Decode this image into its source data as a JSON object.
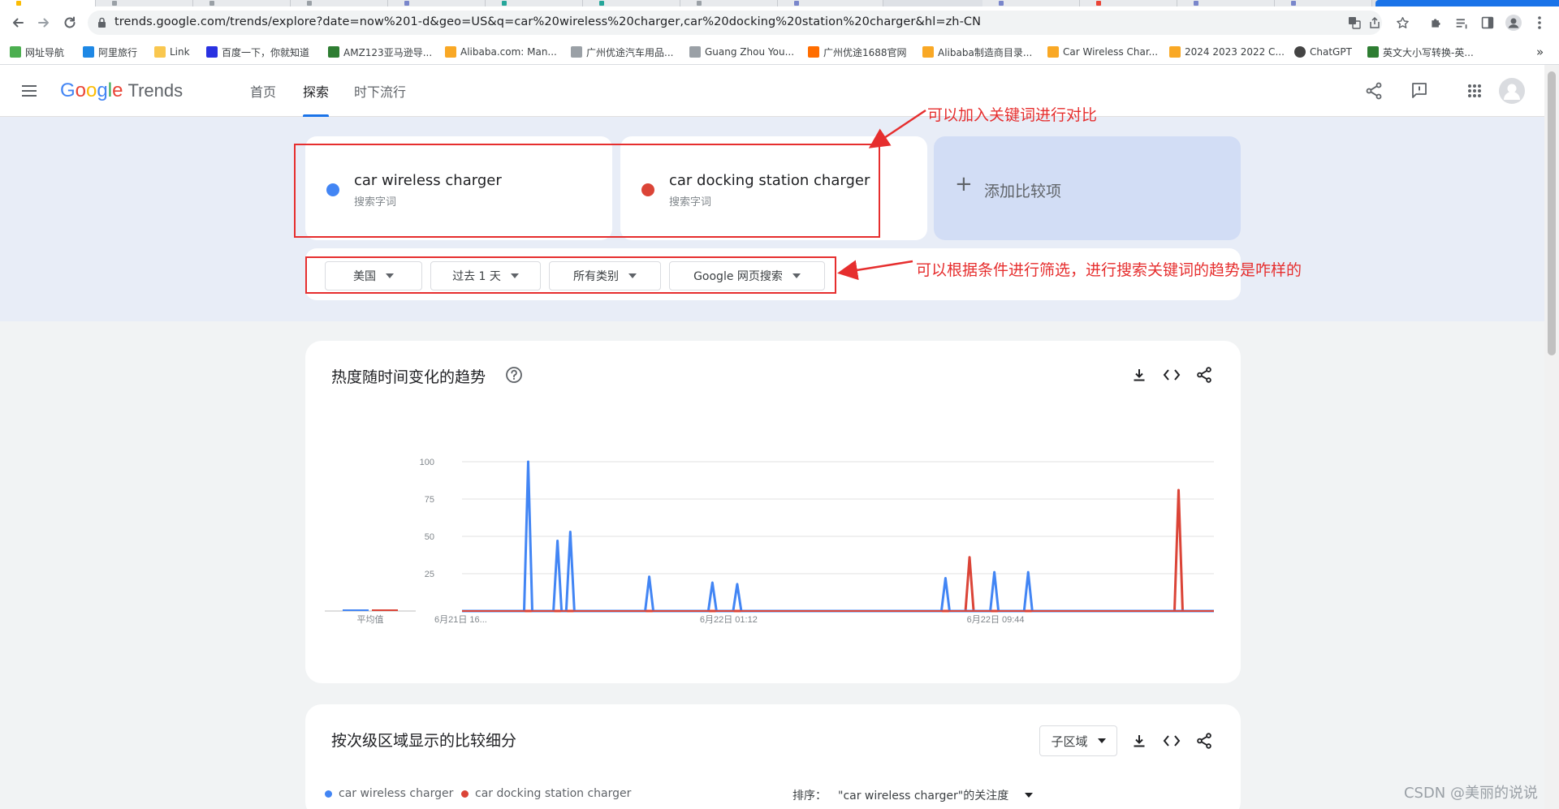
{
  "browser": {
    "url": "trends.google.com/trends/explore?date=now%201-d&geo=US&q=car%20wireless%20charger,car%20docking%20station%20charger&hl=zh-CN",
    "bookmarks": [
      {
        "label": "网址导航",
        "color": "#4caf50"
      },
      {
        "label": "阿里旅行",
        "color": "#1e88e5"
      },
      {
        "label": "Link",
        "color": "#f9c74f"
      },
      {
        "label": "百度一下，你就知道",
        "color": "#2932e1"
      },
      {
        "label": "AMZ123亚马逊导...",
        "color": "#2e7d32"
      },
      {
        "label": "Alibaba.com: Man...",
        "color": "#f9a825"
      },
      {
        "label": "广州优途汽车用品...",
        "color": "#9aa0a6"
      },
      {
        "label": "Guang Zhou You...",
        "color": "#9aa0a6"
      },
      {
        "label": "广州优途1688官网",
        "color": "#ff6d00"
      },
      {
        "label": "Alibaba制造商目录...",
        "color": "#f9a825"
      },
      {
        "label": "Car Wireless Char...",
        "color": "#f9a825"
      },
      {
        "label": "2024 2023 2022 C...",
        "color": "#f9a825"
      },
      {
        "label": "ChatGPT",
        "color": "#444444"
      },
      {
        "label": "英文大小写转换-英...",
        "color": "#2e7d32"
      }
    ],
    "bookmarks_more": "»"
  },
  "header": {
    "logo_google": "Google",
    "logo_trends": "Trends",
    "tabs": [
      "首页",
      "探索",
      "时下流行"
    ],
    "active_tab": 1
  },
  "terms": [
    {
      "name": "car wireless charger",
      "sub": "搜索字词",
      "color": "#4285f4"
    },
    {
      "name": "car docking station charger",
      "sub": "搜索字词",
      "color": "#db4437"
    }
  ],
  "add_compare": {
    "plus": "+",
    "label": "添加比较项"
  },
  "filters": [
    "美国",
    "过去 1 天",
    "所有类别",
    "Google 网页搜索"
  ],
  "annotations": {
    "compare_note": "可以加入关键词进行对比",
    "filter_note": "可以根据条件进行筛选，进行搜索关键词的趋势是咋样的"
  },
  "trend_card": {
    "title": "热度随时间变化的趋势"
  },
  "chart_data": {
    "type": "line",
    "title": "热度随时间变化的趋势",
    "xlabel": "",
    "ylabel": "",
    "ylim": [
      0,
      100
    ],
    "yticks": [
      25,
      50,
      75,
      100
    ],
    "xtick_labels": [
      "6月21日 16...",
      "6月22日 01:12",
      "6月22日 09:44"
    ],
    "average_label": "平均值",
    "average": {
      "car wireless charger": 1,
      "car docking station charger": 0
    },
    "series": [
      {
        "name": "car wireless charger",
        "color": "#4285f4",
        "spikes": [
          {
            "t": 0.088,
            "v": 100
          },
          {
            "t": 0.127,
            "v": 47
          },
          {
            "t": 0.144,
            "v": 53
          },
          {
            "t": 0.249,
            "v": 23
          },
          {
            "t": 0.333,
            "v": 19
          },
          {
            "t": 0.366,
            "v": 18
          },
          {
            "t": 0.643,
            "v": 22
          },
          {
            "t": 0.708,
            "v": 26
          },
          {
            "t": 0.753,
            "v": 26
          }
        ]
      },
      {
        "name": "car docking station charger",
        "color": "#db4437",
        "spikes": [
          {
            "t": 0.675,
            "v": 36
          },
          {
            "t": 0.953,
            "v": 81
          }
        ]
      }
    ]
  },
  "region_card": {
    "title": "按次级区域显示的比较细分",
    "subregion": "子区域",
    "sort_label": "排序：",
    "sort_value": "\"car wireless charger\"的关注度"
  },
  "watermark": "CSDN @美丽的说说"
}
